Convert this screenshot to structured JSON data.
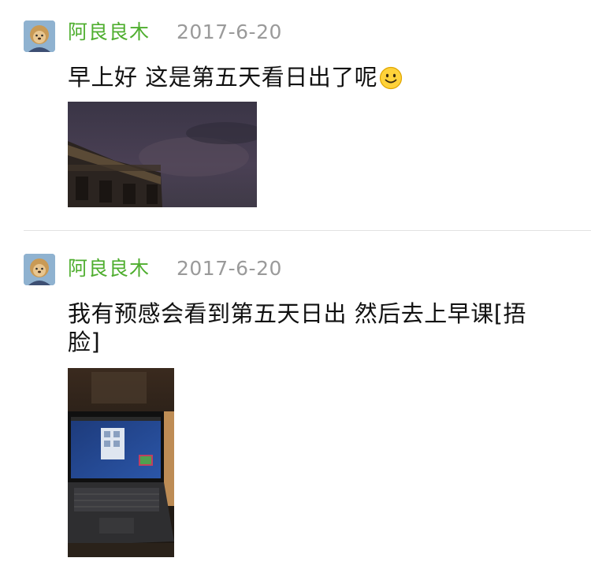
{
  "posts": [
    {
      "author": "阿良良木",
      "date": "2017-6-20",
      "text": "早上好 这是第五天看日出了呢",
      "emoji_icon": "smiling-face-icon"
    },
    {
      "author": "阿良良木",
      "date": "2017-6-20",
      "text": "我有预感会看到第五天日出 然后去上早课[捂脸]"
    }
  ],
  "colors": {
    "author": "#4fae2f",
    "date": "#9a9a9a",
    "text": "#111111",
    "divider": "#e2e2e2",
    "background": "#ffffff"
  }
}
